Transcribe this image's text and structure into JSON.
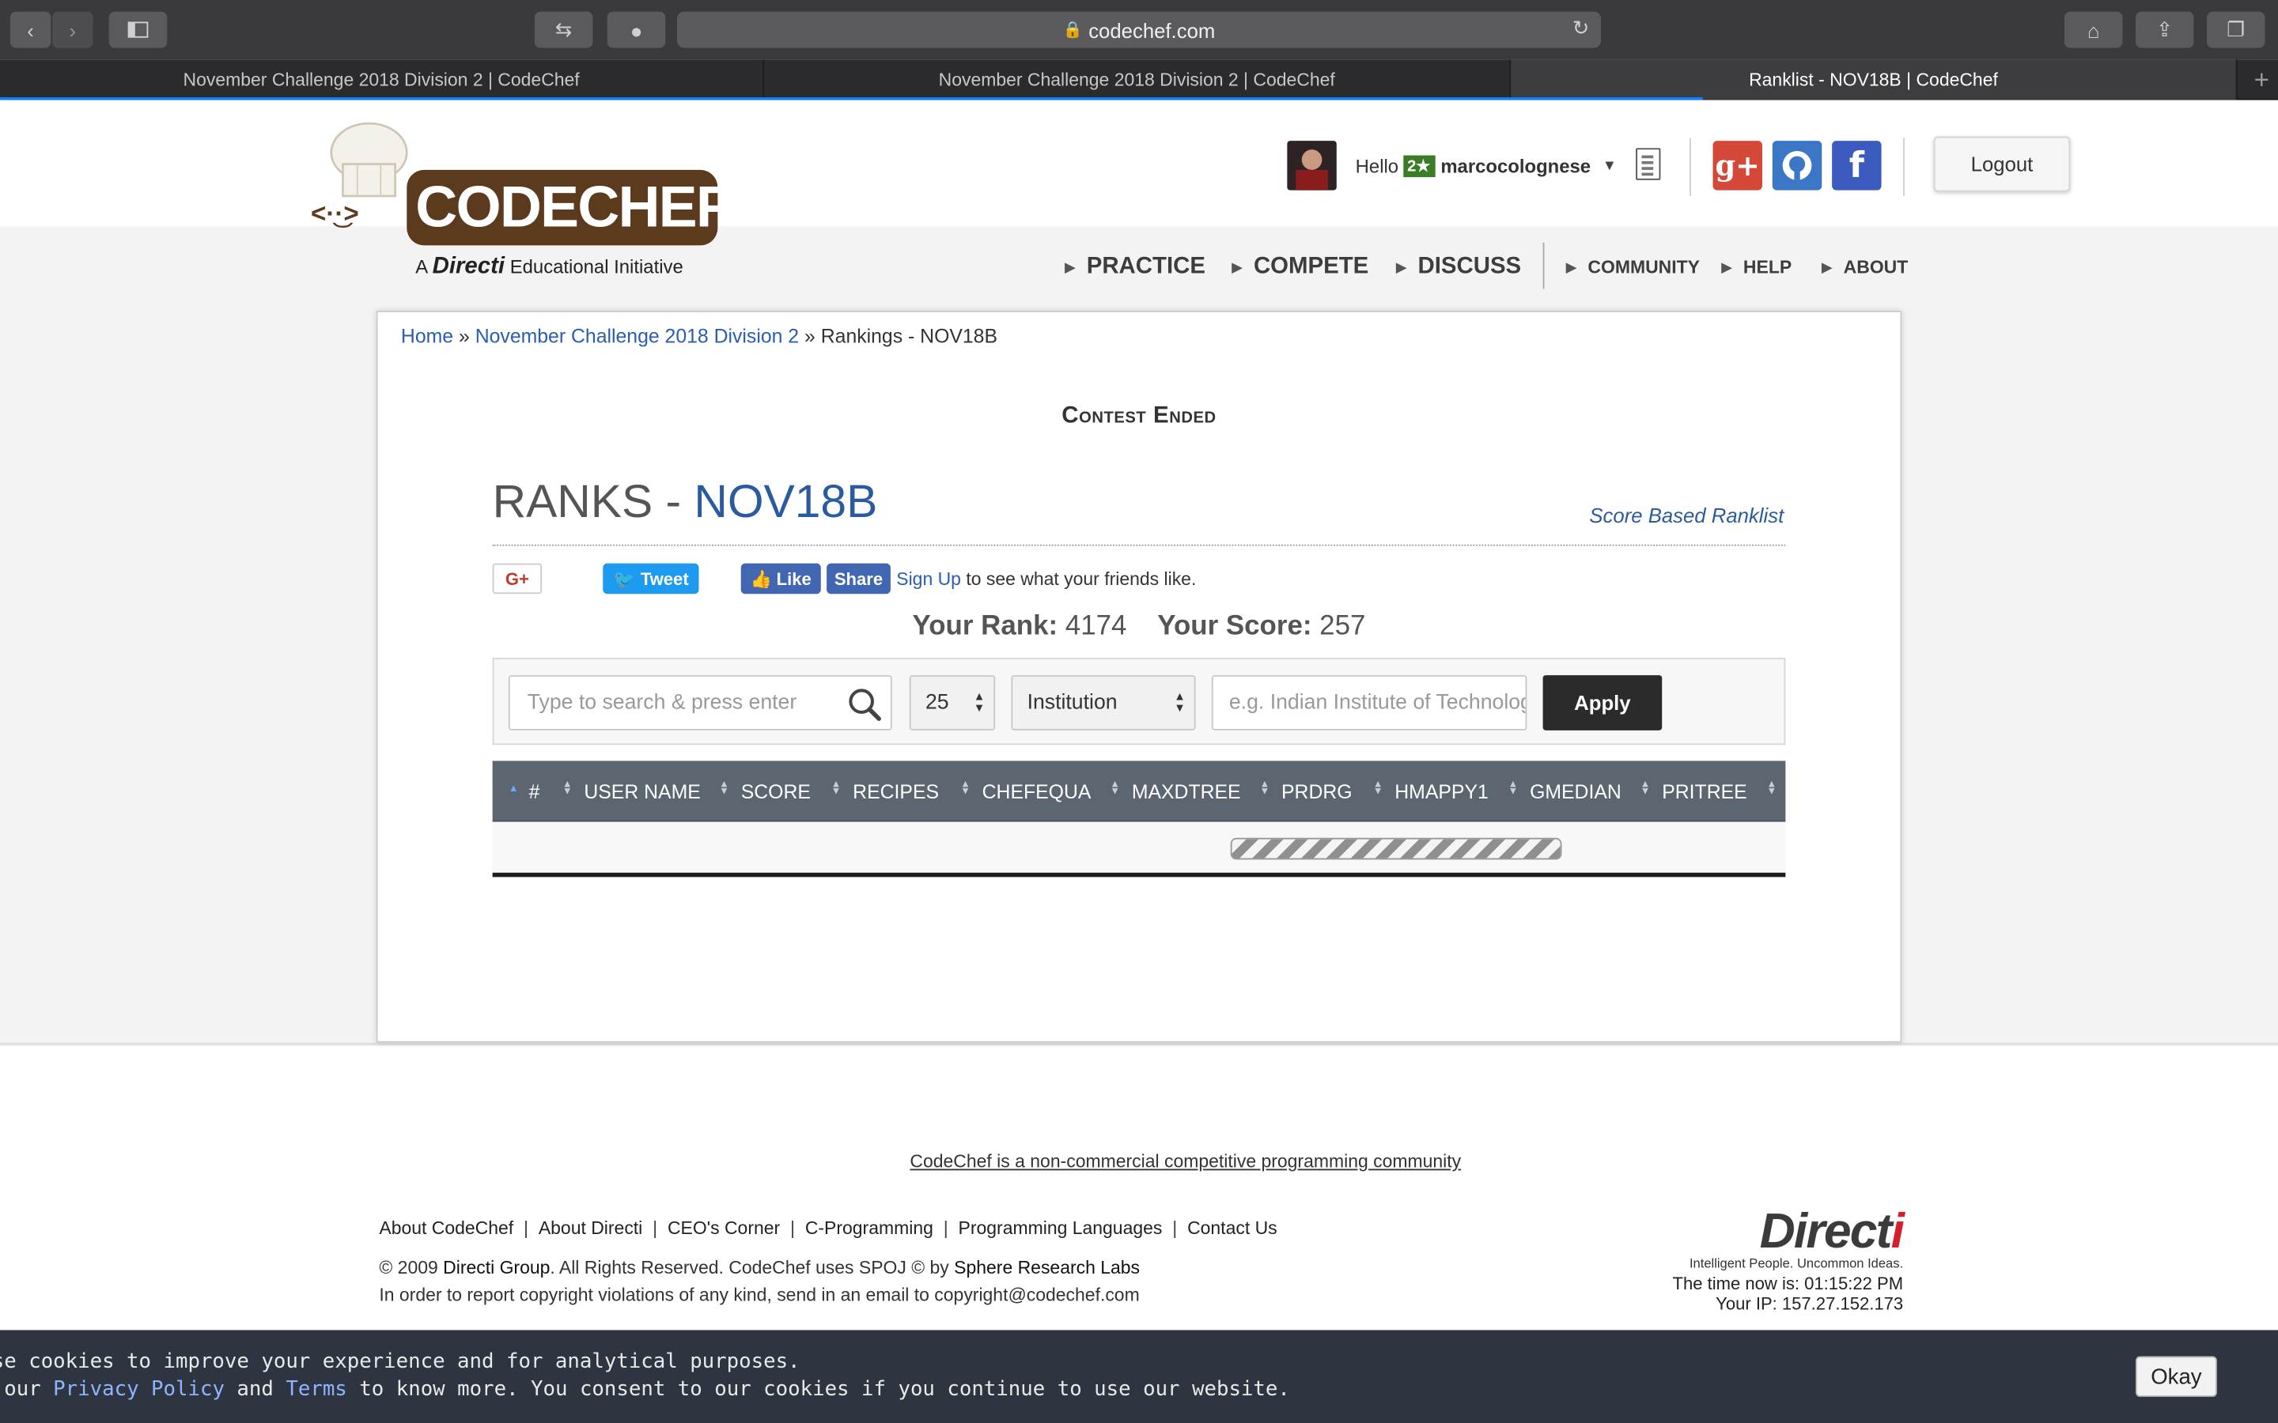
{
  "browser": {
    "url": "codechef.com",
    "tabs": [
      {
        "title": "November Challenge 2018 Division 2 | CodeChef"
      },
      {
        "title": "November Challenge 2018 Division 2 | CodeChef"
      },
      {
        "title": "Ranklist - NOV18B | CodeChef"
      }
    ]
  },
  "logo": {
    "name": "CODECHEF",
    "sub_a": "A",
    "sub_brand": "Directi",
    "sub_rest": "Educational Initiative"
  },
  "user": {
    "hello": "Hello",
    "badge": "2★",
    "username": "marcocolognese"
  },
  "header": {
    "logout": "Logout"
  },
  "nav": {
    "main": [
      "PRACTICE",
      "COMPETE",
      "DISCUSS"
    ],
    "secondary": [
      "COMMUNITY",
      "HELP",
      "ABOUT"
    ]
  },
  "breadcrumb": {
    "home": "Home",
    "contest": "November Challenge 2018 Division 2",
    "sep": "»",
    "current": "Rankings - NOV18B"
  },
  "contest_status": "Contest Ended",
  "ranks": {
    "prefix": "RANKS - ",
    "code": "NOV18B",
    "score_based": "Score Based Ranklist"
  },
  "social": {
    "gplus": "G+",
    "tweet": "Tweet",
    "like": "Like",
    "share": "Share",
    "signup": "Sign Up",
    "signup_rest": "to see what your friends like."
  },
  "your": {
    "rank_label": "Your Rank:",
    "rank": "4174",
    "score_label": "Your Score:",
    "score": "257"
  },
  "filters": {
    "search_placeholder": "Type to search & press enter",
    "page_size": "25",
    "group": "Institution",
    "institution_placeholder": "e.g. Indian Institute of Technolog",
    "apply": "Apply"
  },
  "table": {
    "columns": [
      "#",
      "USER NAME",
      "SCORE",
      "RECIPES",
      "CHEFEQUA",
      "MAXDTREE",
      "PRDRG",
      "HMAPPY1",
      "GMEDIAN",
      "PRITREE"
    ]
  },
  "footer": {
    "community": "CodeChef is a non-commercial competitive programming community",
    "links": [
      "About CodeChef",
      "About Directi",
      "CEO's Corner",
      "C-Programming",
      "Programming Languages",
      "Contact Us"
    ],
    "copy_a": "© 2009 ",
    "copy_directi": "Directi Group",
    "copy_b": ". All Rights Reserved. CodeChef uses SPOJ © by ",
    "copy_sphere": "Sphere Research Labs",
    "copy2": "In order to report copyright violations of any kind, send in an email to copyright@codechef.com",
    "directi_logo": "Directi",
    "directi_tag": "Intelligent People. Uncommon Ideas.",
    "time": "The time now is: 01:15:22 PM",
    "ip": "Your IP: 157.27.152.173"
  },
  "cookie": {
    "line1": "use cookies to improve your experience and for analytical purposes.",
    "line2_a": "d our ",
    "privacy": "Privacy Policy",
    "and": " and ",
    "terms": "Terms",
    "line2_b": " to know more. You consent to our cookies if you continue to use our website.",
    "okay": "Okay"
  }
}
